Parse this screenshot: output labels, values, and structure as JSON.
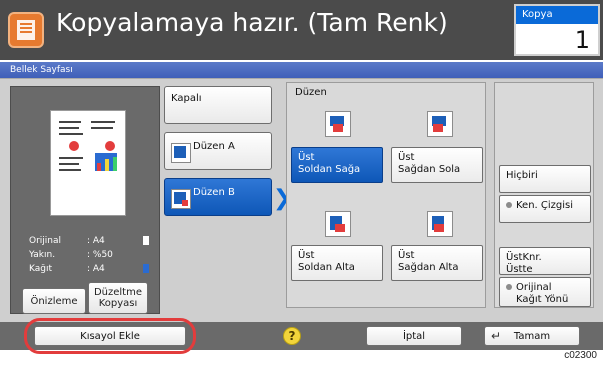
{
  "title_bar": {
    "title": "Kopyalamaya hazır. (Tam Renk)",
    "copy_label": "Kopya",
    "copy_count": "1"
  },
  "header": {
    "label": "Bellek Sayfası"
  },
  "preview": {
    "info": [
      {
        "key": "Orijinal",
        "value": ": A4"
      },
      {
        "key": "Yakın.",
        "value": ": %50"
      },
      {
        "key": "Kağıt",
        "value": ": A4"
      }
    ],
    "buttons": {
      "preview": "Önizleme",
      "correction_line1": "Düzeltme",
      "correction_line2": "Kopyası"
    }
  },
  "options": {
    "off": "Kapalı",
    "layout_a": "Düzen A",
    "layout_b": "Düzen B"
  },
  "duzen": {
    "title": "Düzen",
    "items": [
      {
        "line1": "Üst",
        "line2": "Soldan Sağa"
      },
      {
        "line1": "Üst",
        "line2": "Sağdan Sola"
      },
      {
        "line1": "Üst",
        "line2": "Soldan Alta"
      },
      {
        "line1": "Üst",
        "line2": "Sağdan Alta"
      }
    ]
  },
  "right_options": {
    "none": "Hiçbiri",
    "border_line": "Ken. Çizgisi",
    "cornertop_line1": "ÜstKnr.",
    "cornertop_line2": "Üstte",
    "orig_line1": "Orijinal",
    "orig_line2": "Kağıt Yönü"
  },
  "bottom_bar": {
    "add_shortcut": "Kısayol Ekle",
    "help": "?",
    "cancel": "İptal",
    "ok": "Tamam"
  },
  "footer_code": "c02300",
  "colors": {
    "accent_blue": "#0a6ad8",
    "header_blue": "#4a67bf",
    "highlight_red": "#e23c3c"
  }
}
